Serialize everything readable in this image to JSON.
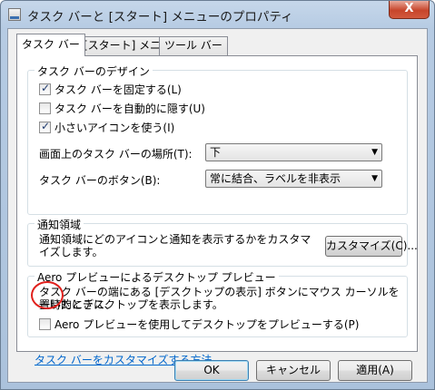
{
  "window": {
    "title": "タスク バーと [スタート] メニューのプロパティ",
    "close_glyph": "X"
  },
  "tabs": [
    {
      "label": "タスク バー"
    },
    {
      "label": "[スタート] メニュー"
    },
    {
      "label": "ツール バー"
    }
  ],
  "design_group": {
    "title": "タスク バーのデザイン",
    "lock_taskbar": {
      "label": "タスク バーを固定する(L)",
      "checked": true
    },
    "autohide": {
      "label": "タスク バーを自動的に隠す(U)",
      "checked": false
    },
    "small_icons": {
      "label": "小さいアイコンを使う(I)",
      "checked": true
    },
    "location_label": "画面上のタスク バーの場所(T):",
    "location_value": "下",
    "buttons_label": "タスク バーのボタン(B):",
    "buttons_value": "常に結合、ラベルを非表示"
  },
  "notification_group": {
    "title": "通知領域",
    "description": "通知領域にどのアイコンと通知を表示するかをカスタマイズします。",
    "customize_button": "カスタマイズ(C)..."
  },
  "aero_group": {
    "title": "Aero プレビューによるデスクトップ プレビュー",
    "description_line1": "タスク バーの端にある [デスクトップの表示] ボタンにマウス カーソルを置いたときに、",
    "description_line2": "一時的にデスクトップを表示します。",
    "use_peek": {
      "label": "Aero プレビューを使用してデスクトップをプレビューする(P)",
      "checked": false
    }
  },
  "help_link": "タスク バーをカスタマイズする方法",
  "footer": {
    "ok": "OK",
    "cancel": "キャンセル",
    "apply": "適用(A)"
  },
  "annotation_color": "#e0201c"
}
